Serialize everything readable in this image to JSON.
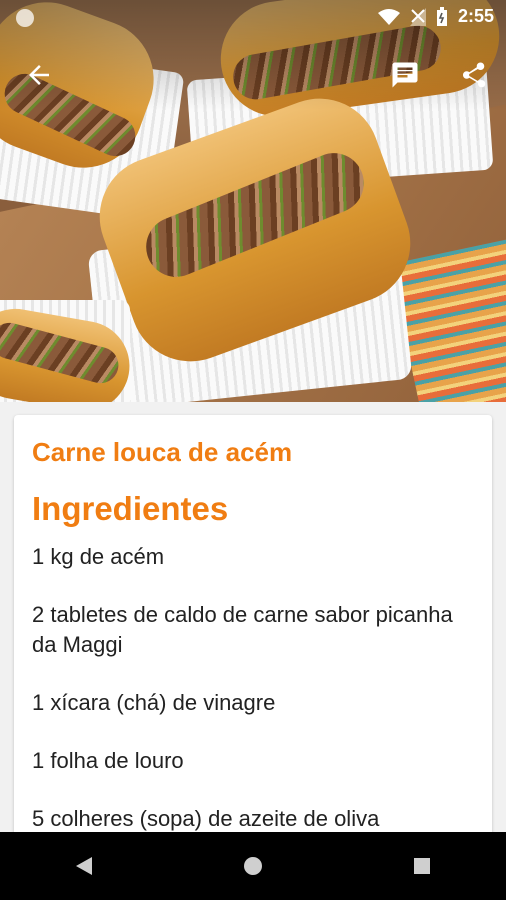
{
  "status_bar": {
    "time": "2:55"
  },
  "app_bar": {
    "back_icon": "arrow-back-icon",
    "comments_icon": "comment-icon",
    "share_icon": "share-icon"
  },
  "recipe": {
    "title": "Carne louca de acém",
    "section_heading": "Ingredientes",
    "ingredients": [
      "1 kg de acém",
      "2 tabletes de caldo de carne sabor picanha da Maggi",
      "1 xícara (chá) de vinagre",
      "1 folha de louro",
      "5 colheres (sopa) de azeite de oliva"
    ]
  },
  "nav_bar": {
    "back": "nav-back-icon",
    "home": "nav-home-icon",
    "recents": "nav-recents-icon"
  },
  "colors": {
    "accent": "#f07d12",
    "text": "#222222",
    "navbar": "#000000"
  }
}
